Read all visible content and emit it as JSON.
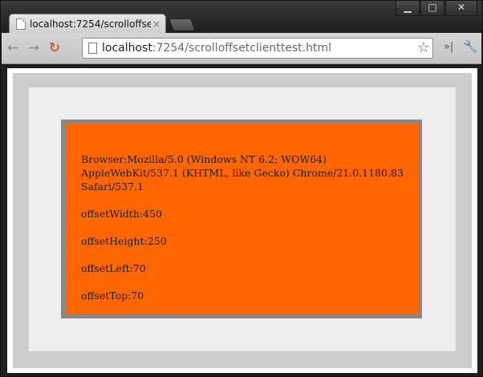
{
  "window": {
    "controls": {
      "minimize": "▁",
      "maximize": "□",
      "close": "✕"
    }
  },
  "tab": {
    "title": "localhost:7254/scrolloffse",
    "close": "×",
    "favicon": "page-icon"
  },
  "toolbar": {
    "back": "←",
    "forward": "→",
    "reload": "↻",
    "url_host": "localhost",
    "url_rest": ":7254/scrolloffsetclienttest.html",
    "star": "☆",
    "extensions": "»|",
    "wrench": "🔧"
  },
  "content": {
    "browser": "Browser:Mozilla/5.0 (Windows NT 6.2; WOW64) AppleWebKit/537.1 (KHTML, like Gecko) Chrome/21.0.1180.83 Safari/537.1",
    "offsetWidth": "offsetWidth:450",
    "offsetHeight": "offsetHeight:250",
    "offsetLeft": "offsetLeft:70",
    "offsetTop": "offsetTop:70"
  },
  "colors": {
    "box": "#ff6600",
    "box_border": "#888888",
    "outer": "#cccccc",
    "inner": "#eeeeee"
  }
}
